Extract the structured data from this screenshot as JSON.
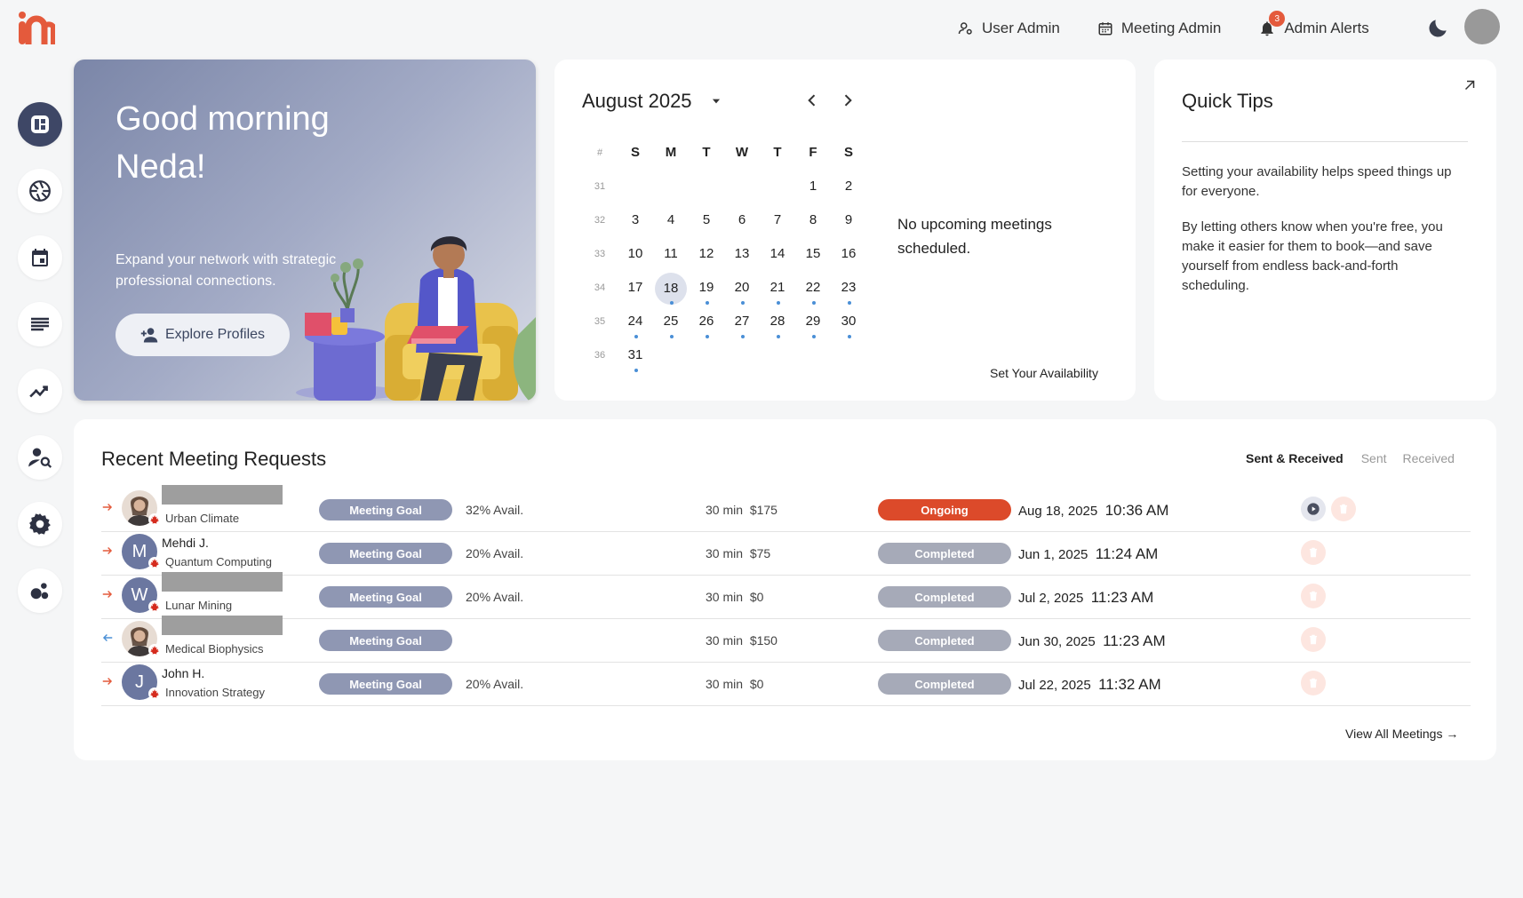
{
  "topnav": {
    "user_admin": "User Admin",
    "meeting_admin": "Meeting Admin",
    "admin_alerts": "Admin Alerts",
    "alerts_count": "3"
  },
  "colors": {
    "accent": "#e45a3c",
    "sidebar_active": "#3e4766",
    "ongoing": "#dc4a2a",
    "completed": "#a6aab8",
    "goal": "#8f97b3",
    "dot": "#4a8fd6"
  },
  "sidebar": {
    "items": [
      {
        "icon": "dashboard-icon"
      },
      {
        "icon": "aperture-icon"
      },
      {
        "icon": "calendar-icon"
      },
      {
        "icon": "list-icon"
      },
      {
        "icon": "trending-icon"
      },
      {
        "icon": "user-search-icon"
      },
      {
        "icon": "settings-icon"
      },
      {
        "icon": "bubbles-icon"
      }
    ]
  },
  "hero": {
    "greeting": "Good morning Neda!",
    "text": "Expand your network with strategic professional connections.",
    "button": "Explore Profiles"
  },
  "calendar": {
    "month": "August 2025",
    "week_header": "#",
    "days": [
      "S",
      "M",
      "T",
      "W",
      "T",
      "F",
      "S"
    ],
    "weeks": [
      {
        "n": "31",
        "d": [
          "",
          "",
          "",
          "",
          "",
          "1",
          "2"
        ]
      },
      {
        "n": "32",
        "d": [
          "3",
          "4",
          "5",
          "6",
          "7",
          "8",
          "9"
        ]
      },
      {
        "n": "33",
        "d": [
          "10",
          "11",
          "12",
          "13",
          "14",
          "15",
          "16"
        ]
      },
      {
        "n": "34",
        "d": [
          "17",
          "18",
          "19",
          "20",
          "21",
          "22",
          "23"
        ]
      },
      {
        "n": "35",
        "d": [
          "24",
          "25",
          "26",
          "27",
          "28",
          "29",
          "30"
        ]
      },
      {
        "n": "36",
        "d": [
          "31",
          "",
          "",
          "",
          "",
          "",
          ""
        ]
      }
    ],
    "today": "18",
    "dotted": [
      "18",
      "19",
      "20",
      "21",
      "22",
      "23",
      "24",
      "25",
      "26",
      "27",
      "28",
      "29",
      "30",
      "31"
    ],
    "no_meetings": "No upcoming meetings scheduled.",
    "availability": "Set Your Availability"
  },
  "tips": {
    "title": "Quick Tips",
    "p1": "Setting your availability helps speed things up for everyone.",
    "p2": "By letting others know when you're free, you make it easier for them to book—and save yourself from endless back-and-forth scheduling."
  },
  "requests": {
    "title": "Recent Meeting Requests",
    "filters": [
      "Sent & Received",
      "Sent",
      "Received"
    ],
    "view_all": "View All Meetings →",
    "rows": [
      {
        "dir": "out",
        "avatar": "photo",
        "initial": "",
        "name": "",
        "field": "Urban Climate",
        "goal": "Meeting Goal",
        "avail": "32% Avail.",
        "duration": "30 min",
        "price": "$175",
        "status": "Ongoing",
        "date": "Aug 18, 2025",
        "time": "10:36 AM"
      },
      {
        "dir": "out",
        "avatar": "letter",
        "initial": "M",
        "name": "Mehdi J.",
        "field": "Quantum Computing",
        "goal": "Meeting Goal",
        "avail": "20% Avail.",
        "duration": "30 min",
        "price": "$75",
        "status": "Completed",
        "date": "Jun 1, 2025",
        "time": "11:24 AM"
      },
      {
        "dir": "out",
        "avatar": "letter",
        "initial": "W",
        "name": "",
        "field": "Lunar Mining",
        "goal": "Meeting Goal",
        "avail": "20% Avail.",
        "duration": "30 min",
        "price": "$0",
        "status": "Completed",
        "date": "Jul 2, 2025",
        "time": "11:23 AM"
      },
      {
        "dir": "in",
        "avatar": "photo",
        "initial": "",
        "name": "",
        "field": "Medical Biophysics",
        "goal": "Meeting Goal",
        "avail": "",
        "duration": "30 min",
        "price": "$150",
        "status": "Completed",
        "date": "Jun 30, 2025",
        "time": "11:23 AM"
      },
      {
        "dir": "out",
        "avatar": "letter",
        "initial": "J",
        "name": "John H.",
        "field": "Innovation Strategy",
        "goal": "Meeting Goal",
        "avail": "20% Avail.",
        "duration": "30 min",
        "price": "$0",
        "status": "Completed",
        "date": "Jul 22, 2025",
        "time": "11:32 AM"
      }
    ]
  }
}
